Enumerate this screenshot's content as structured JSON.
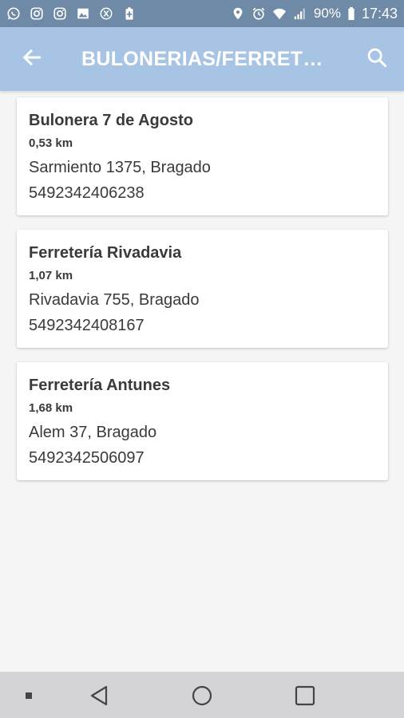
{
  "status_bar": {
    "left_icons": [
      "whatsapp-icon",
      "instagram-icon",
      "instagram-icon",
      "gallery-icon",
      "accessibility-icon",
      "battery-saver-icon"
    ],
    "battery": "90%",
    "time": "17:43"
  },
  "app_bar": {
    "title": "BULONERIAS/FERRETE..."
  },
  "stores": [
    {
      "name": "Bulonera 7 de Agosto",
      "distance": "0,53 km",
      "address": "Sarmiento 1375, Bragado",
      "phone": "5492342406238"
    },
    {
      "name": "Ferretería Rivadavia",
      "distance": "1,07 km",
      "address": "Rivadavia 755, Bragado",
      "phone": "5492342408167"
    },
    {
      "name": "Ferretería Antunes",
      "distance": "1,68 km",
      "address": "Alem 37, Bragado",
      "phone": "5492342506097"
    }
  ],
  "colors": {
    "status_bar": "#6f8aa6",
    "app_bar": "#a8c4e4",
    "background": "#f5f5f5",
    "nav_bar": "#d4d4d7"
  }
}
